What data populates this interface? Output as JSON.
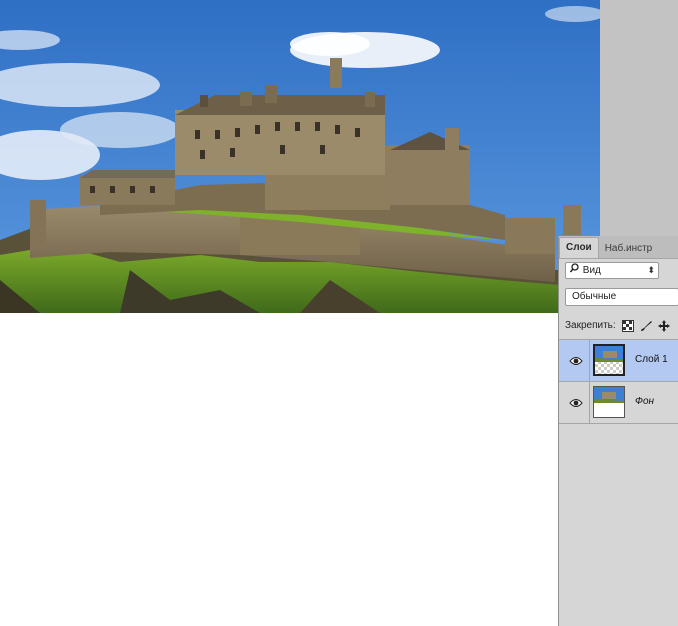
{
  "layers_panel": {
    "tabs": [
      {
        "label": "Слои",
        "active": true
      },
      {
        "label": "Наб.инстр",
        "active": false
      }
    ],
    "filter": {
      "value": "Вид",
      "icon": "search-icon"
    },
    "blend_mode": {
      "value": "Обычные"
    },
    "lock": {
      "label": "Закрепить:",
      "icons": [
        "lock-transparent-pixels-icon",
        "lock-image-pixels-icon",
        "lock-position-icon"
      ]
    },
    "layers": [
      {
        "name": "Слой 1",
        "visible": true,
        "selected": true,
        "thumbnail": "castle-with-transparency"
      },
      {
        "name": "Фон",
        "visible": true,
        "selected": false,
        "thumbnail": "castle-on-white",
        "italic": true
      }
    ]
  },
  "colors": {
    "panel_bg": "#d6d6d6",
    "selected_layer": "#b3c9f2",
    "pasteboard": "#c3c3c3",
    "sky": "#3d7fd0"
  }
}
